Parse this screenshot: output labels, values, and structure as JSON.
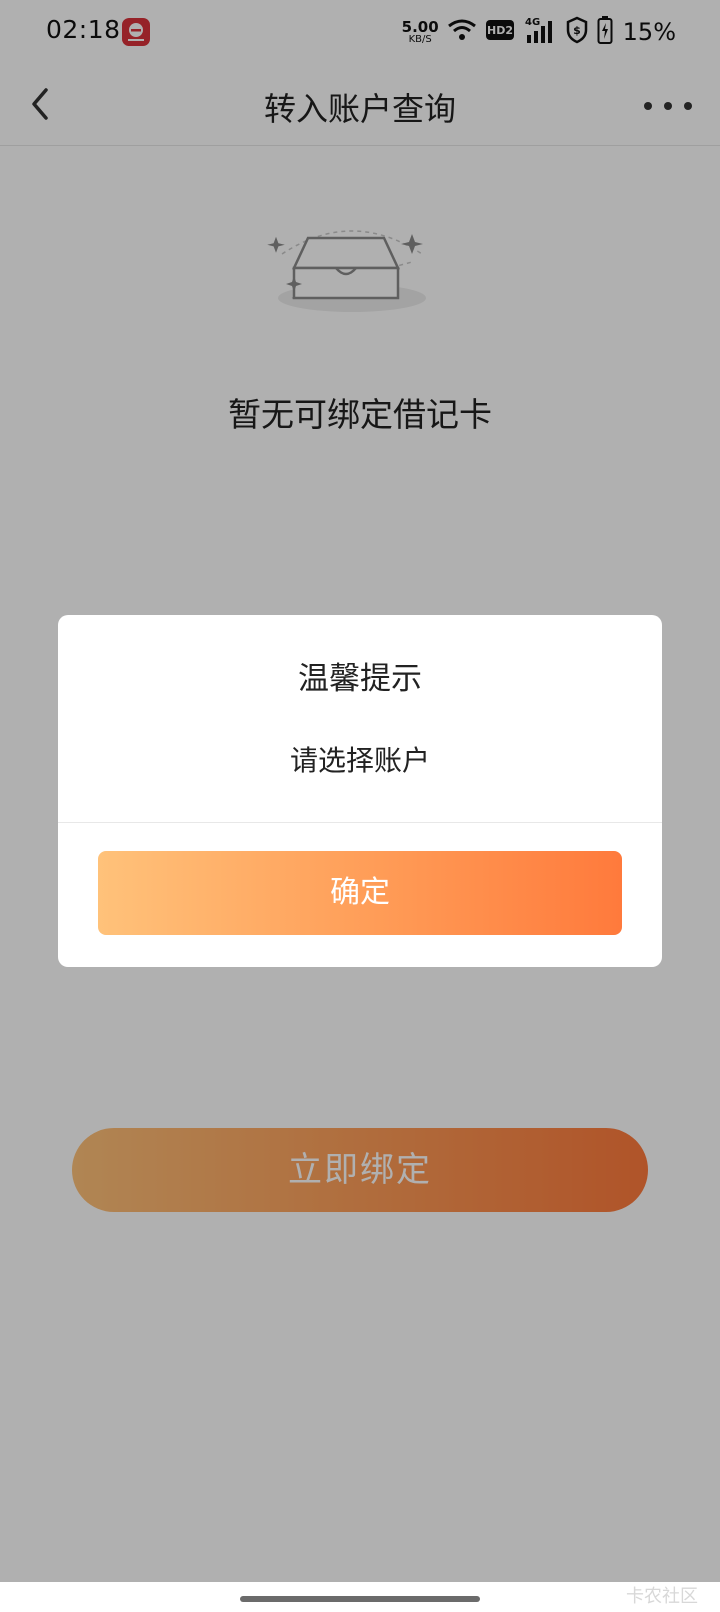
{
  "status_bar": {
    "time": "02:18",
    "net_speed_value": "5.00",
    "net_speed_unit": "KB/S",
    "hd_label": "HD2",
    "signal_label": "4G",
    "battery_percent": "15%"
  },
  "header": {
    "title": "转入账户查询"
  },
  "empty_state": {
    "message": "暂无可绑定借记卡"
  },
  "bind_button": {
    "label": "立即绑定"
  },
  "dialog": {
    "title": "温馨提示",
    "message": "请选择账户",
    "confirm_label": "确定"
  },
  "watermark": {
    "text": "卡农社区"
  },
  "colors": {
    "accent_start": "#ffc27a",
    "accent_end": "#ff7a3c",
    "mask": "rgba(0,0,0,0.31)"
  }
}
